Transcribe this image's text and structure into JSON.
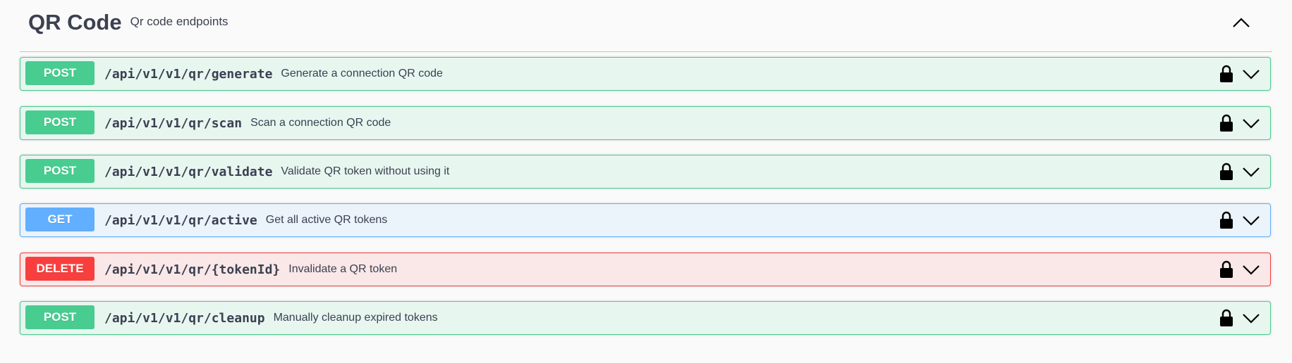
{
  "tag": {
    "title": "QR Code",
    "description": "Qr code endpoints",
    "collapse_icon": "chevron-up-icon"
  },
  "operations": [
    {
      "method": "POST",
      "path": "/api/v1/v1/qr/generate",
      "summary": "Generate a connection QR code",
      "color": "#49cc90"
    },
    {
      "method": "POST",
      "path": "/api/v1/v1/qr/scan",
      "summary": "Scan a connection QR code",
      "color": "#49cc90"
    },
    {
      "method": "POST",
      "path": "/api/v1/v1/qr/validate",
      "summary": "Validate QR token without using it",
      "color": "#49cc90"
    },
    {
      "method": "GET",
      "path": "/api/v1/v1/qr/active",
      "summary": "Get all active QR tokens",
      "color": "#61affe"
    },
    {
      "method": "DELETE",
      "path": "/api/v1/v1/qr/{tokenId}",
      "summary": "Invalidate a QR token",
      "color": "#f93e3e"
    },
    {
      "method": "POST",
      "path": "/api/v1/v1/qr/cleanup",
      "summary": "Manually cleanup expired tokens",
      "color": "#49cc90"
    }
  ],
  "icons": {
    "lock": "lock-icon",
    "expand": "chevron-down-icon"
  }
}
